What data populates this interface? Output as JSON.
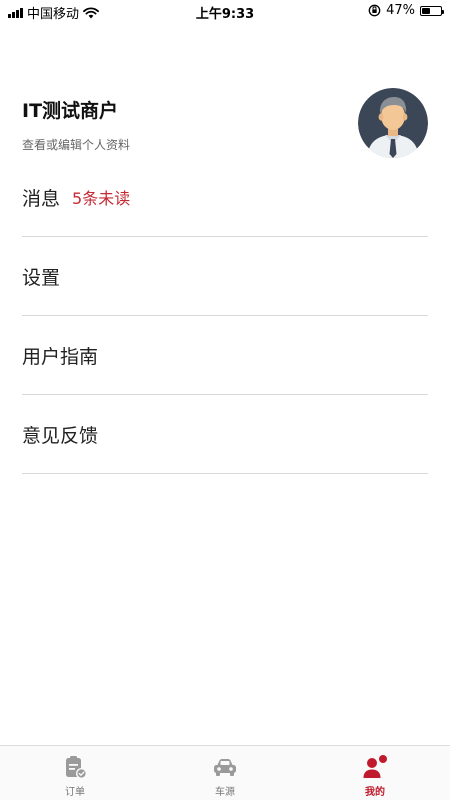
{
  "status_bar": {
    "carrier": "中国移动",
    "time": "上午9:33",
    "battery_text": "47%",
    "battery_level": 0.47
  },
  "profile": {
    "name": "IT测试商户",
    "edit_label": "查看或编辑个人资料",
    "avatar_icon": "businessman-avatar-icon"
  },
  "menu": {
    "messages_label": "消息",
    "messages_badge": "5条未读",
    "settings_label": "设置",
    "guide_label": "用户指南",
    "feedback_label": "意见反馈"
  },
  "tabs": {
    "orders_label": "订单",
    "cars_label": "车源",
    "mine_label": "我的",
    "active": "mine"
  },
  "colors": {
    "accent": "#c01b2c",
    "badge_red": "#c62a35",
    "tab_inactive": "#9a9a9a",
    "divider": "#d9d9d9"
  }
}
